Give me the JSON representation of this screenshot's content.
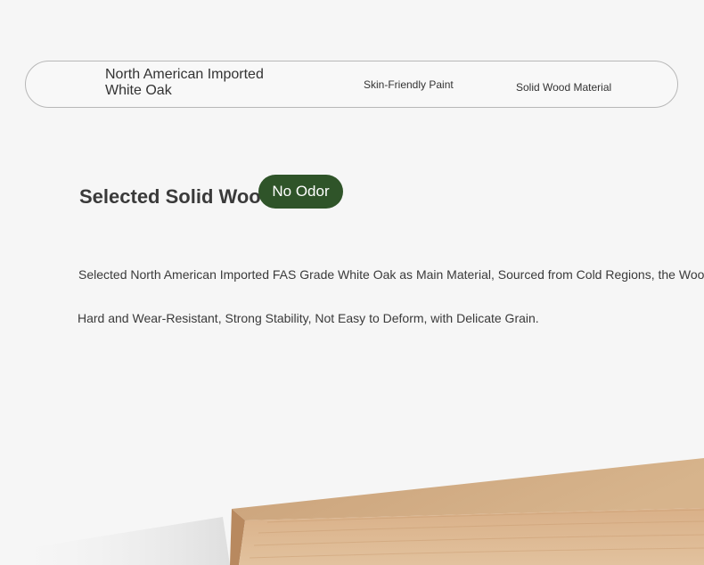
{
  "features": {
    "item1": "North American Imported White Oak",
    "item2": "Skin-Friendly Paint",
    "item3": "Solid Wood Material"
  },
  "section": {
    "title": "Selected Solid Wood",
    "badge": "No Odor",
    "description_line1": "Selected North American Imported FAS Grade White Oak as Main Material, Sourced from Cold Regions, the Wood is",
    "description_line2": "Hard and Wear-Resistant, Strong Stability, Not Easy to Deform, with Delicate Grain."
  },
  "colors": {
    "background": "#f6f6f6",
    "badge": "#2f5429",
    "border": "#b8b8b8",
    "wood": "#d4ac82"
  }
}
